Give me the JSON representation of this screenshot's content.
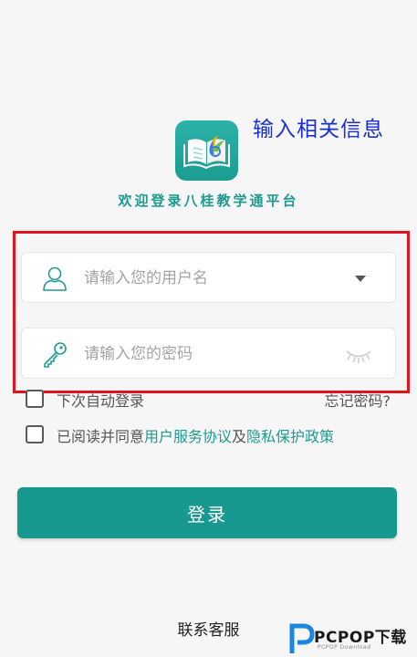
{
  "annotation": "输入相关信息",
  "welcome": "欢迎登录八桂教学通平台",
  "username": {
    "placeholder": "请输入您的用户名"
  },
  "password": {
    "placeholder": "请输入您的密码"
  },
  "auto_login_label": "下次自动登录",
  "forgot_password": "忘记密码?",
  "agreement": {
    "prefix": "已阅读并同意",
    "terms": "用户服务协议",
    "and": "及",
    "privacy": "隐私保护政策"
  },
  "login_label": "登录",
  "contact_label": "联系客服",
  "watermark": {
    "brand": "PCPOP下载",
    "sub": "PCPOP Download"
  },
  "colors": {
    "brand_teal": "#18998f",
    "annotation_blue": "#1a2fd6",
    "highlight_red": "#e3121b"
  }
}
